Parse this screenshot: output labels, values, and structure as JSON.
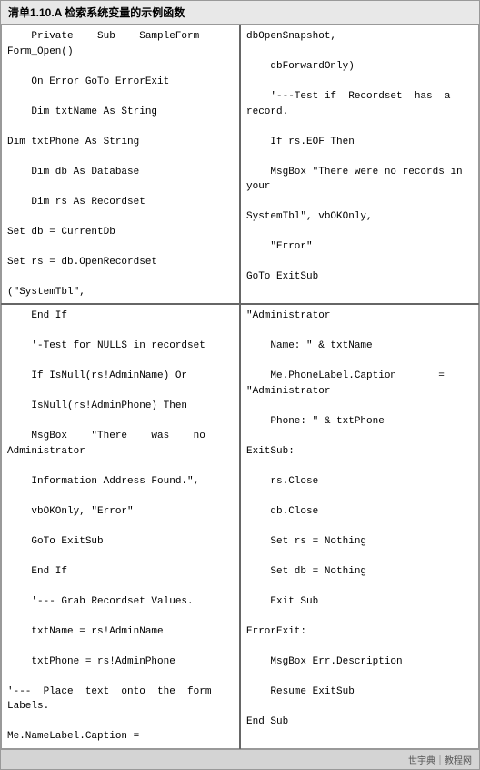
{
  "header": {
    "title": "清单1.10.A 检索系统变量的示例函数"
  },
  "sections": [
    {
      "left": "    Private    Sub    SampleForm\nForm_Open()\n\n    On Error GoTo ErrorExit\n\n    Dim txtName As String\n\nDim txtPhone As String\n\n    Dim db As Database\n\n    Dim rs As Recordset\n\nSet db = CurrentDb\n\nSet rs = db.OpenRecordset\n\n(\"SystemTbl\",",
      "right": "dbOpenSnapshot,\n\n    dbForwardOnly)\n\n    '---Test if  Recordset  has  a\nrecord.\n\n    If rs.EOF Then\n\n    MsgBox \"There were no records in\nyour\n\nSystemTbl\", vbOKOnly,\n\n    \"Error\"\n\nGoTo ExitSub"
    },
    {
      "left": "    End If\n\n    '-Test for NULLS in recordset\n\n    If IsNull(rs!AdminName) Or\n\n    IsNull(rs!AdminPhone) Then\n\n    MsgBox    \"There    was    no\nAdministrator\n\n    Information Address Found.\",\n\n    vbOKOnly, \"Error\"\n\n    GoTo ExitSub\n\n    End If\n\n    '--- Grab Recordset Values.\n\n    txtName = rs!AdminName\n\n    txtPhone = rs!AdminPhone\n\n'---  Place  text  onto  the  form\nLabels.\n\nMe.NameLabel.Caption =",
      "right": "\"Administrator\n\n    Name: \" & txtName\n\n    Me.PhoneLabel.Caption       =\n\"Administrator\n\n    Phone: \" & txtPhone\n\nExitSub:\n\n    rs.Close\n\n    db.Close\n\n    Set rs = Nothing\n\n    Set db = Nothing\n\n    Exit Sub\n\nErrorExit:\n\n    MsgBox Err.Description\n\n    Resume ExitSub\n\nEnd Sub"
    }
  ],
  "footer": {
    "text": "世宇典｜教程网"
  }
}
